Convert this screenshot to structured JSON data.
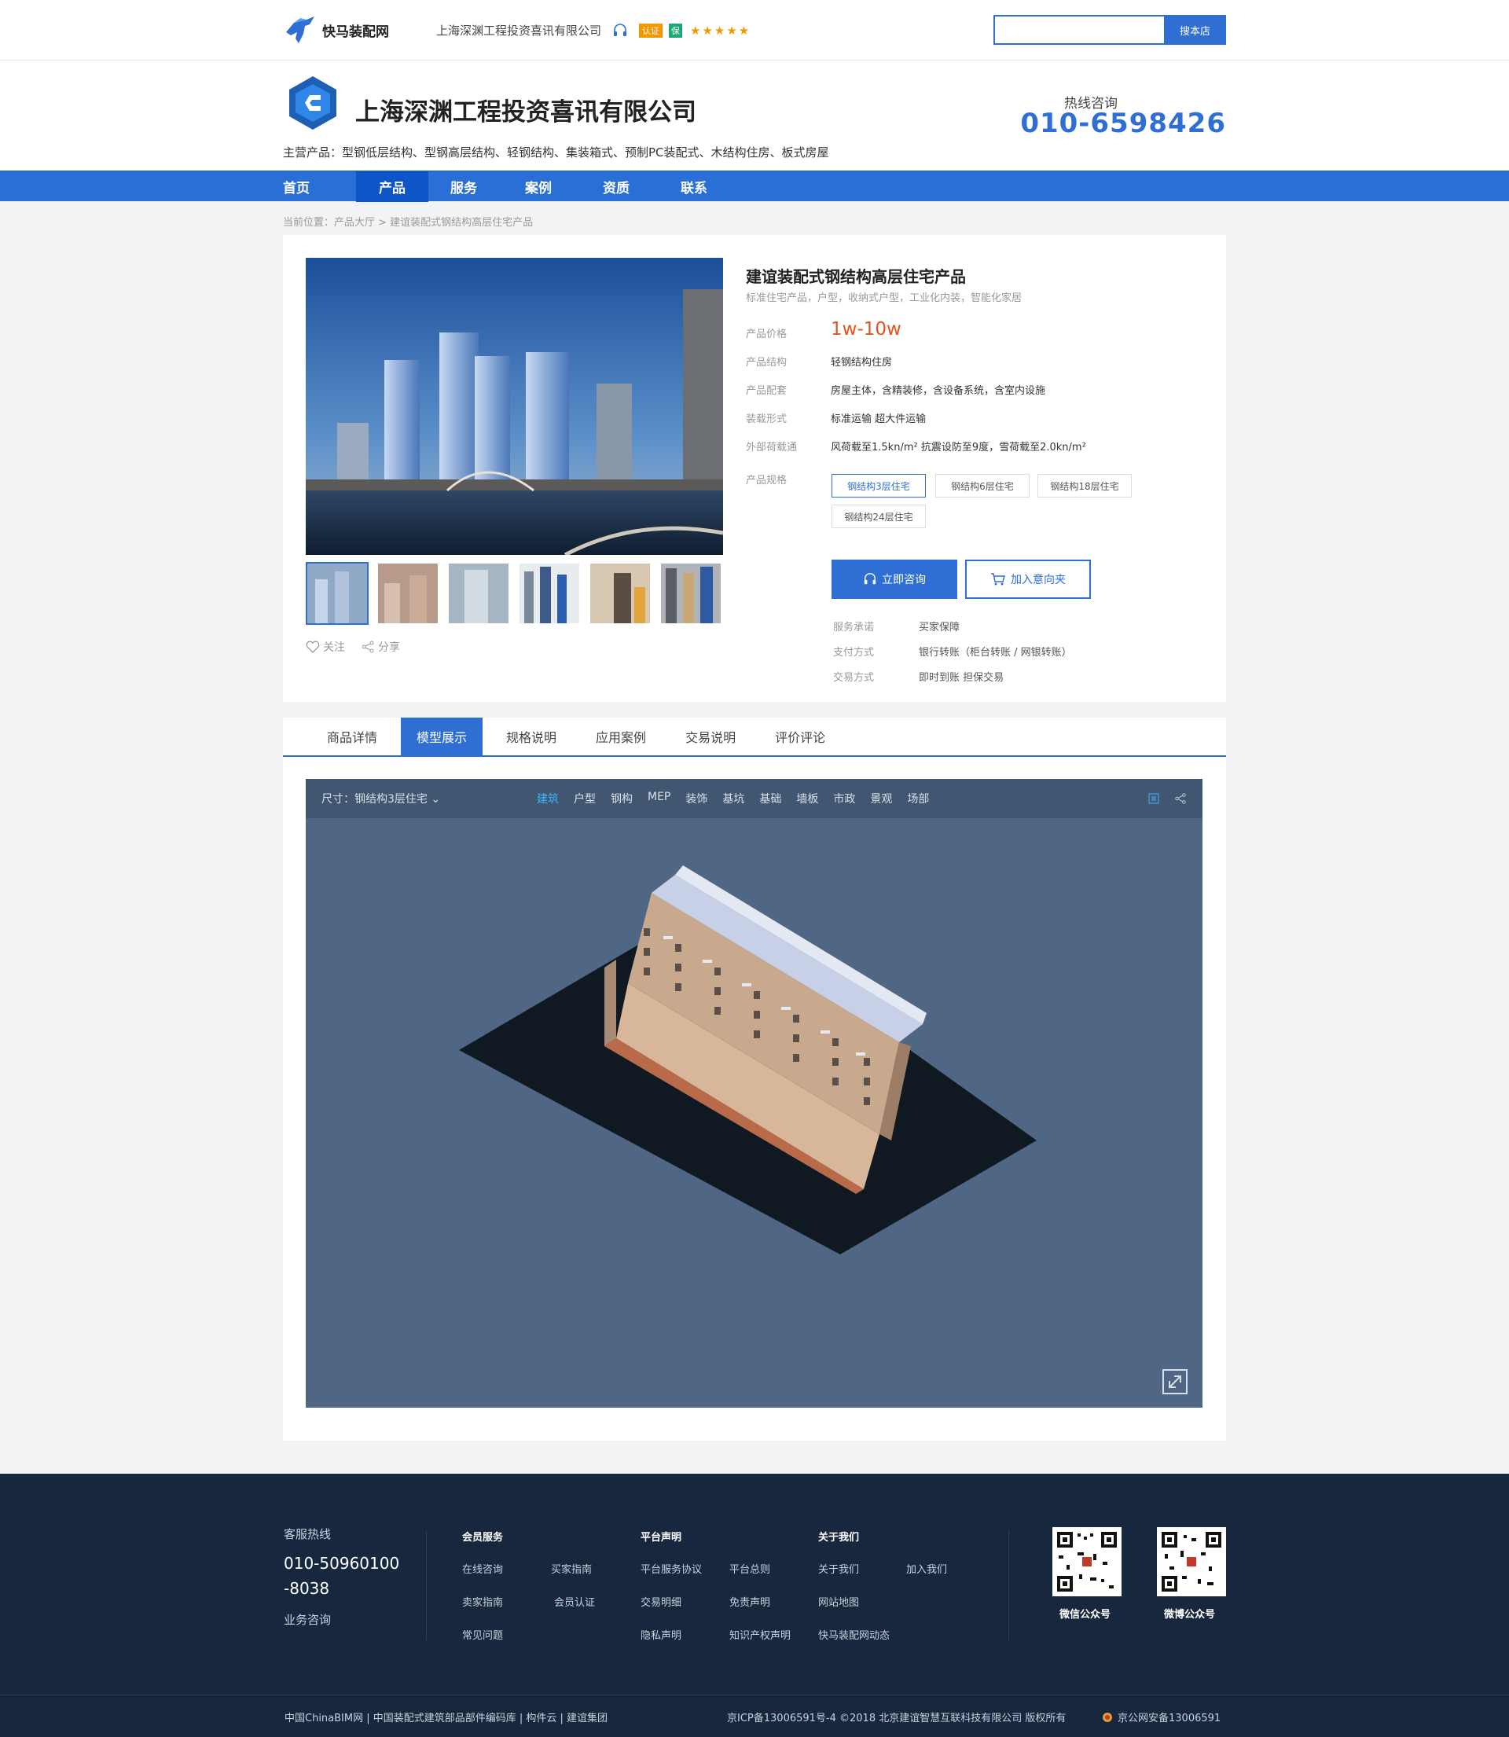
{
  "topbar": {
    "logo_text": "快马装配网",
    "company": "上海深渊工程投资喜讯有限公司",
    "badge_rz": "认证",
    "badge_g": "保",
    "stars": "★★★★★",
    "search_placeholder": "",
    "search_button": "搜本店"
  },
  "header": {
    "company_name": "上海深渊工程投资喜讯有限公司",
    "main_products": "主营产品：型钢低层结构、型钢高层结构、轻钢结构、集装箱式、预制PC装配式、木结构住房、板式房屋",
    "hotline_label": "热线咨询",
    "hotline": "010-6598426"
  },
  "nav": [
    "首页",
    "产品",
    "服务",
    "案例",
    "资质",
    "联系"
  ],
  "breadcrumb": "当前位置：产品大厅 > 建谊装配式钢结构高层住宅产品",
  "product": {
    "title": "建谊装配式钢结构高层住宅产品",
    "subtitle": "标准住宅产品，户型，收纳式户型，工业化内装，智能化家居",
    "price_label": "产品价格",
    "price": "1w-10w",
    "structure_label": "产品结构",
    "structure": "轻钢结构住房",
    "config_label": "产品配套",
    "config": "房屋主体，含精装修，含设备系统，含室内设施",
    "transport_label": "装载形式",
    "transport": "标准运输   超大件运输",
    "load_label": "外部荷载通",
    "load": "风荷载至1.5kn/m²  抗震设防至9度，雪荷载至2.0kn/m²",
    "spec_label": "产品规格",
    "specs": [
      "钢结构3层住宅",
      "钢结构6层住宅",
      "钢结构18层住宅",
      "钢结构24层住宅"
    ],
    "consult_button": "立即咨询",
    "cart_button": "加入意向夹",
    "follow": "关注",
    "share": "分享",
    "service_label": "服务承诺",
    "service": "买家保障",
    "pay_label": "支付方式",
    "pay": "银行转账（柜台转账 / 网银转账）",
    "trade_label": "交易方式",
    "trade": "即时到账   担保交易"
  },
  "tabs": [
    "商品详情",
    "模型展示",
    "规格说明",
    "应用案例",
    "交易说明",
    "评价评论"
  ],
  "viewer": {
    "size_label": "尺寸：钢结构3层住宅",
    "tabs": [
      "建筑",
      "户型",
      "钢构",
      "MEP",
      "装饰",
      "基坑",
      "基础",
      "墙板",
      "市政",
      "景观",
      "场部"
    ]
  },
  "footer": {
    "service_title": "客服热线",
    "phone_1": "010-50960100",
    "phone_2": "-8038",
    "consult": "业务咨询",
    "col1_title": "会员服务",
    "col1_items": [
      "在线咨询",
      "买家指南",
      "卖家指南",
      "会员认证",
      "常见问题"
    ],
    "col2_title": "平台声明",
    "col2_items": [
      "平台服务协议",
      "平台总则",
      "交易明细",
      "免责声明",
      "隐私声明",
      "知识产权声明"
    ],
    "col3_title": "关于我们",
    "col3_items": [
      "关于我们",
      "加入我们",
      "网站地图",
      "快马装配网动态"
    ],
    "qr1": "微信公众号",
    "qr2": "微博公众号",
    "bottom_left": "中国ChinaBIM网 | 中国装配式建筑部品部件编码库 | 构件云 | 建谊集团",
    "bottom_mid": "京ICP备13006591号-4  ©2018 北京建谊智慧互联科技有限公司 版权所有",
    "bottom_right": "京公网安备13006591"
  },
  "colors": {
    "primary": "#2f6fd3",
    "nav": "#2a6fd6",
    "price": "#e4531a",
    "footer": "#17273d",
    "viewer_bg": "#4f6785"
  }
}
